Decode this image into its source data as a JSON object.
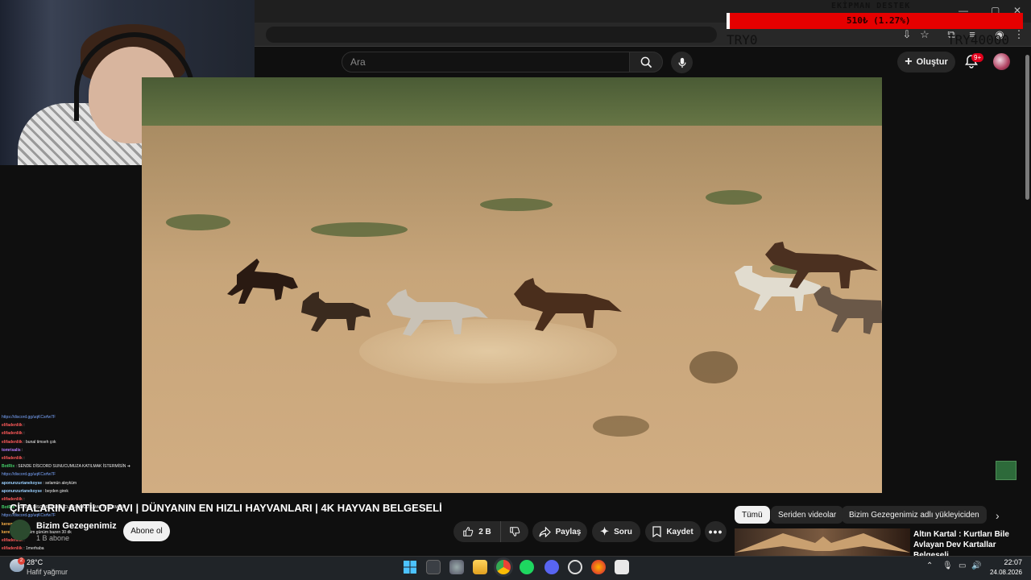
{
  "donation": {
    "title": "EKİPMAN DESTEK",
    "progress_text": "510₺ (1.27%)",
    "progress_fraction": 0.0127,
    "min_label": "TRY0",
    "max_label": "TRY40000",
    "bar_color": "#e60000"
  },
  "youtube": {
    "search_placeholder": "Ara",
    "create_label": "Oluştur",
    "notification_badge": "9+"
  },
  "video": {
    "title": "ÇİTALARIN ANTİLOP AVI | DÜNYANIN EN HIZLI HAYVANLARI | 4K HAYVAN BELGESELİ",
    "channel_name": "Bizim Gezegenimiz",
    "channel_subs": "1 B abone",
    "subscribe_label": "Abone ol",
    "like_count": "2 B",
    "share_label": "Paylaş",
    "ask_label": "Soru",
    "save_label": "Kaydet"
  },
  "chips": [
    "Tümü",
    "Seriden videolar",
    "Bizim Gezegenimiz adlı yükleyiciden"
  ],
  "recommended": {
    "title": "Altın Kartal : Kurtları Bile Avlayan Dev Kartallar Belgeseli"
  },
  "chat": [
    {
      "user": "",
      "text": "https://discord.gg/uqKCsrfw7F",
      "color": "#7aa6ff"
    },
    {
      "user": "elifadenliik",
      "text": ":",
      "color": "#ff5a5a"
    },
    {
      "user": "elifadenliik",
      "text": ":",
      "color": "#ff5a5a"
    },
    {
      "user": "elifadenliik",
      "text": ": bunal timseh çok",
      "color": "#ff5a5a"
    },
    {
      "user": "tomrisalis",
      "text": ":",
      "color": "#b77cff"
    },
    {
      "user": "elifadenliik",
      "text": ":",
      "color": "#ff5a5a"
    },
    {
      "user": "BotRix",
      "text": ": SENDE DİSCORD SUNUCUMUZA KATILMAK İSTERMİSİN ➜",
      "color": "#44d06a"
    },
    {
      "user": "",
      "text": "https://discord.gg/uqKCsrfw7F",
      "color": "#7aa6ff"
    },
    {
      "user": "aponunzurtanekoyse",
      "text": ": selamün aleyküm",
      "color": "#9ad0ff"
    },
    {
      "user": "aponunzurtanekoyse",
      "text": ": beyden girek",
      "color": "#9ad0ff"
    },
    {
      "user": "elifadenliik",
      "text": ":",
      "color": "#ff5a5a"
    },
    {
      "user": "BotRix",
      "text": ": SENDE DİSCORD SUNUCUMUZA KATILMAK İSTERMİSİN",
      "color": "#44d06a"
    },
    {
      "user": "",
      "text": "https://discord.gg/uqKCsrfw7F",
      "color": "#7aa6ff"
    },
    {
      "user": "keremadd",
      "text": ": ...",
      "color": "#ffb347"
    },
    {
      "user": "keremadd",
      "text": ": benim günüm bazen 30 dk",
      "color": "#ffb347"
    },
    {
      "user": "elifadenliik",
      "text": ":",
      "color": "#ff5a5a"
    },
    {
      "user": "elifadenliik",
      "text": ": 1merhaba",
      "color": "#ff5a5a"
    }
  ],
  "taskbar": {
    "temperature": "28°C",
    "weather": "Hafif yağmur",
    "weather_badge": "2",
    "time": "22:07",
    "date": "24.08.2026"
  },
  "colors": {
    "background": "#0f0f0f",
    "pill": "#272727",
    "taskbar": "#202428"
  }
}
